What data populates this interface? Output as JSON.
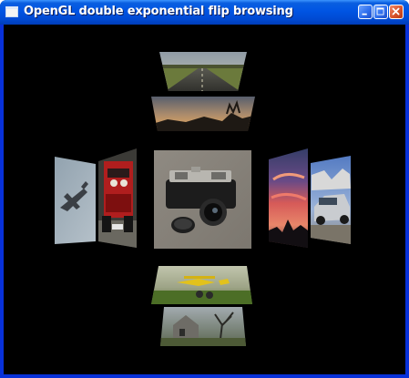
{
  "window": {
    "title": "OpenGL double exponential flip browsing",
    "controls": {
      "minimize": "minimize",
      "maximize": "maximize",
      "close": "close"
    }
  },
  "photos": {
    "center": "camera",
    "top_far": "road",
    "top_near": "sunset",
    "left_far": "airplane",
    "left_near": "red-car",
    "right_near": "sunset-sky",
    "right_far": "silver-car",
    "bottom_near": "yellow-aircraft",
    "bottom_far": "ruined-house"
  },
  "colors": {
    "titlebar": "#0054e3",
    "frame": "#0831d9",
    "canvas": "#000000",
    "close_button": "#d8532b"
  }
}
